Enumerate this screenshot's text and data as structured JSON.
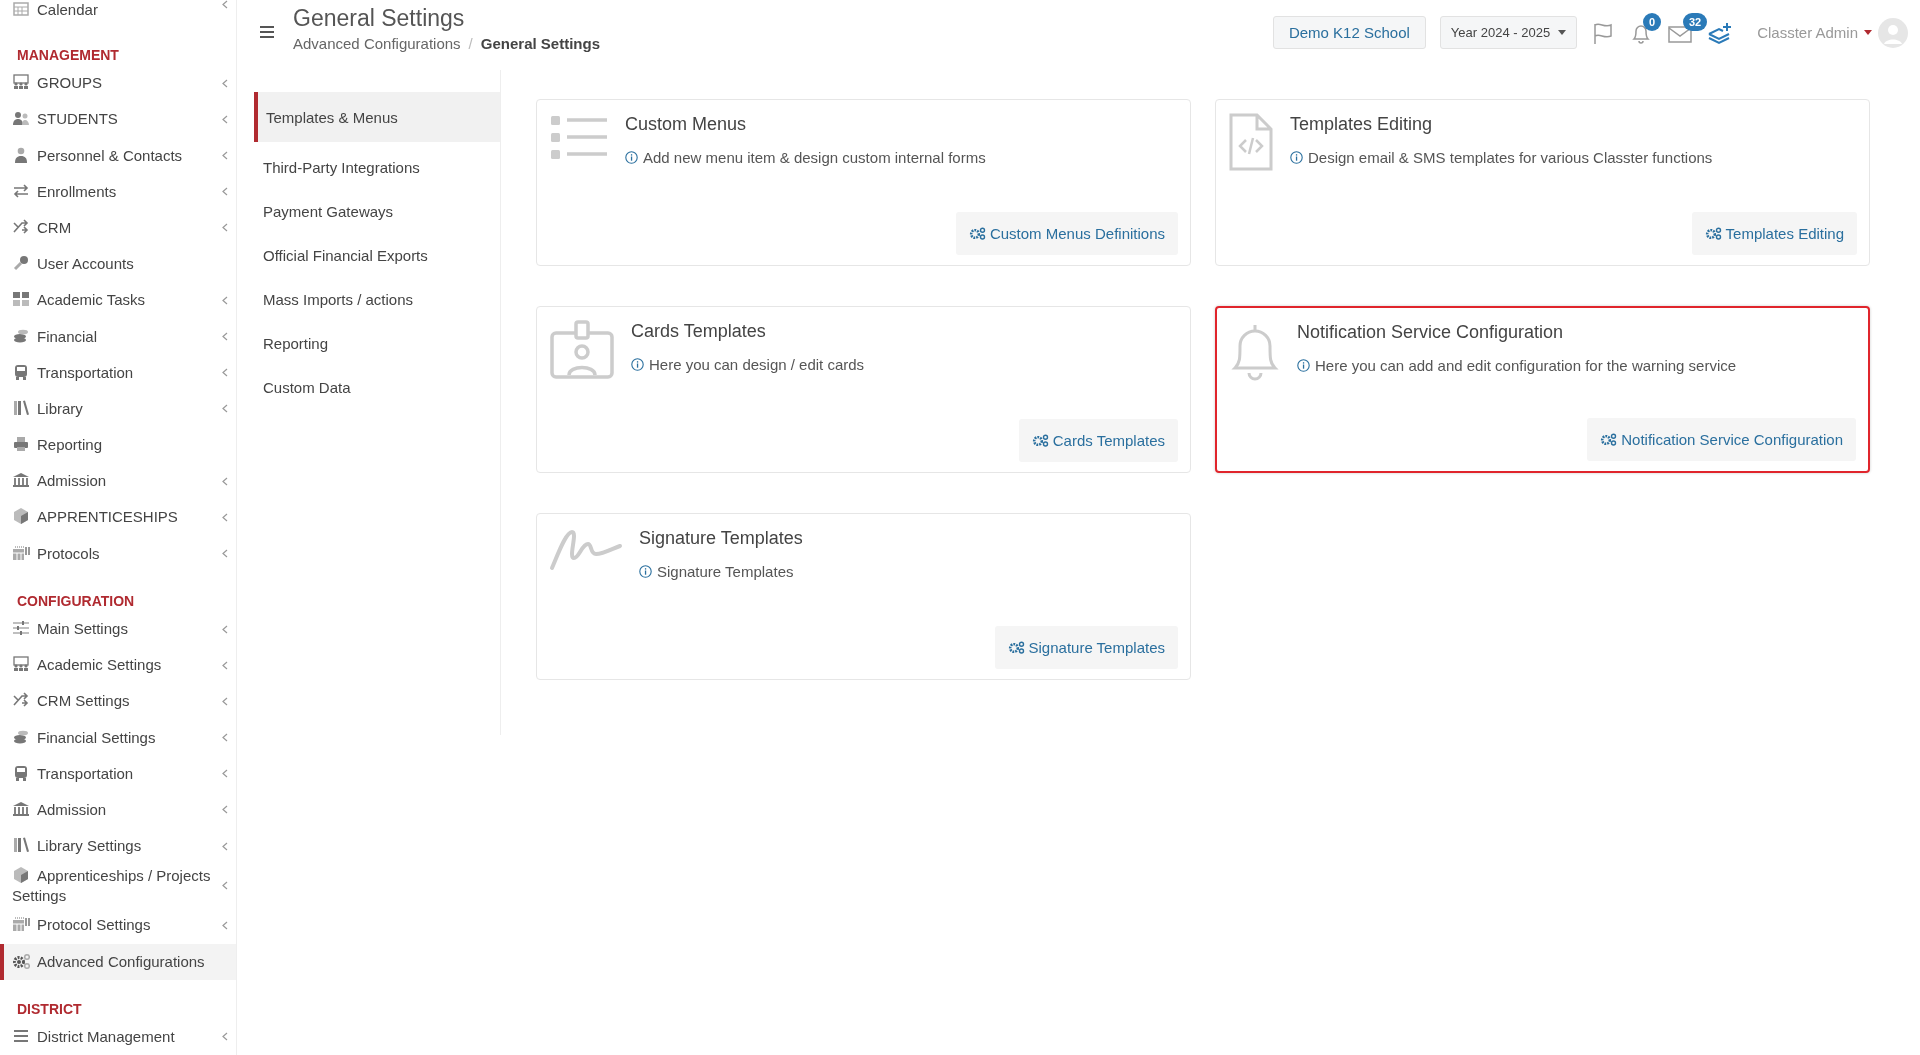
{
  "sidebar": {
    "sections": [
      {
        "items": [
          {
            "label": "Calendar",
            "expandable": true,
            "selected": false
          }
        ]
      },
      {
        "title": "MANAGEMENT",
        "items": [
          {
            "label": "GROUPS",
            "expandable": true,
            "selected": false
          },
          {
            "label": "STUDENTS",
            "expandable": true,
            "selected": false
          },
          {
            "label": "Personnel & Contacts",
            "expandable": true,
            "selected": false
          },
          {
            "label": "Enrollments",
            "expandable": true,
            "selected": false
          },
          {
            "label": "CRM",
            "expandable": true,
            "selected": false
          },
          {
            "label": "User Accounts",
            "expandable": false,
            "selected": false
          },
          {
            "label": "Academic Tasks",
            "expandable": true,
            "selected": false
          },
          {
            "label": "Financial",
            "expandable": true,
            "selected": false
          },
          {
            "label": "Transportation",
            "expandable": true,
            "selected": false
          },
          {
            "label": "Library",
            "expandable": true,
            "selected": false
          },
          {
            "label": "Reporting",
            "expandable": false,
            "selected": false
          },
          {
            "label": "Admission",
            "expandable": true,
            "selected": false
          },
          {
            "label": "APPRENTICESHIPS",
            "expandable": true,
            "selected": false
          },
          {
            "label": "Protocols",
            "expandable": true,
            "selected": false
          }
        ]
      },
      {
        "title": "CONFIGURATION",
        "items": [
          {
            "label": "Main Settings",
            "expandable": true,
            "selected": false
          },
          {
            "label": "Academic Settings",
            "expandable": true,
            "selected": false
          },
          {
            "label": "CRM Settings",
            "expandable": true,
            "selected": false
          },
          {
            "label": "Financial Settings",
            "expandable": true,
            "selected": false
          },
          {
            "label": "Transportation",
            "expandable": true,
            "selected": false
          },
          {
            "label": "Admission",
            "expandable": true,
            "selected": false
          },
          {
            "label": "Library Settings",
            "expandable": true,
            "selected": false
          },
          {
            "label": "Apprenticeships / Projects Settings",
            "expandable": true,
            "selected": false
          },
          {
            "label": "Protocol Settings",
            "expandable": true,
            "selected": false
          },
          {
            "label": "Advanced Configurations",
            "expandable": false,
            "selected": true
          }
        ]
      },
      {
        "title": "DISTRICT",
        "items": [
          {
            "label": "District Management",
            "expandable": true,
            "selected": false
          }
        ]
      }
    ]
  },
  "header": {
    "title": "General Settings",
    "breadcrumb": [
      "Advanced Configurations",
      "General Settings"
    ],
    "breadcrumb_separator": "/",
    "school": "Demo K12 School",
    "year": "Year 2024 - 2025",
    "notifications": "0",
    "messages": "32",
    "user": "Classter Admin"
  },
  "settings_nav": [
    {
      "label": "Templates & Menus",
      "selected": true
    },
    {
      "label": "Third-Party Integrations",
      "selected": false
    },
    {
      "label": "Payment Gateways",
      "selected": false
    },
    {
      "label": "Official Financial Exports",
      "selected": false
    },
    {
      "label": "Mass Imports / actions",
      "selected": false
    },
    {
      "label": "Reporting",
      "selected": false
    },
    {
      "label": "Custom Data",
      "selected": false
    }
  ],
  "cards": [
    {
      "title": "Custom Menus",
      "description": "Add new menu item & design custom internal forms",
      "button": "Custom Menus Definitions",
      "highlighted": false
    },
    {
      "title": "Templates Editing",
      "description": "Design email & SMS templates for various Classter functions",
      "button": "Templates Editing",
      "highlighted": false
    },
    {
      "title": "Cards Templates",
      "description": "Here you can design / edit cards",
      "button": "Cards Templates",
      "highlighted": false
    },
    {
      "title": "Notification Service Configuration",
      "description": "Here you can add and edit configuration for the warning service",
      "button": "Notification Service Configuration",
      "highlighted": true
    },
    {
      "title": "Signature Templates",
      "description": "Signature Templates",
      "button": "Signature Templates",
      "highlighted": false
    }
  ]
}
